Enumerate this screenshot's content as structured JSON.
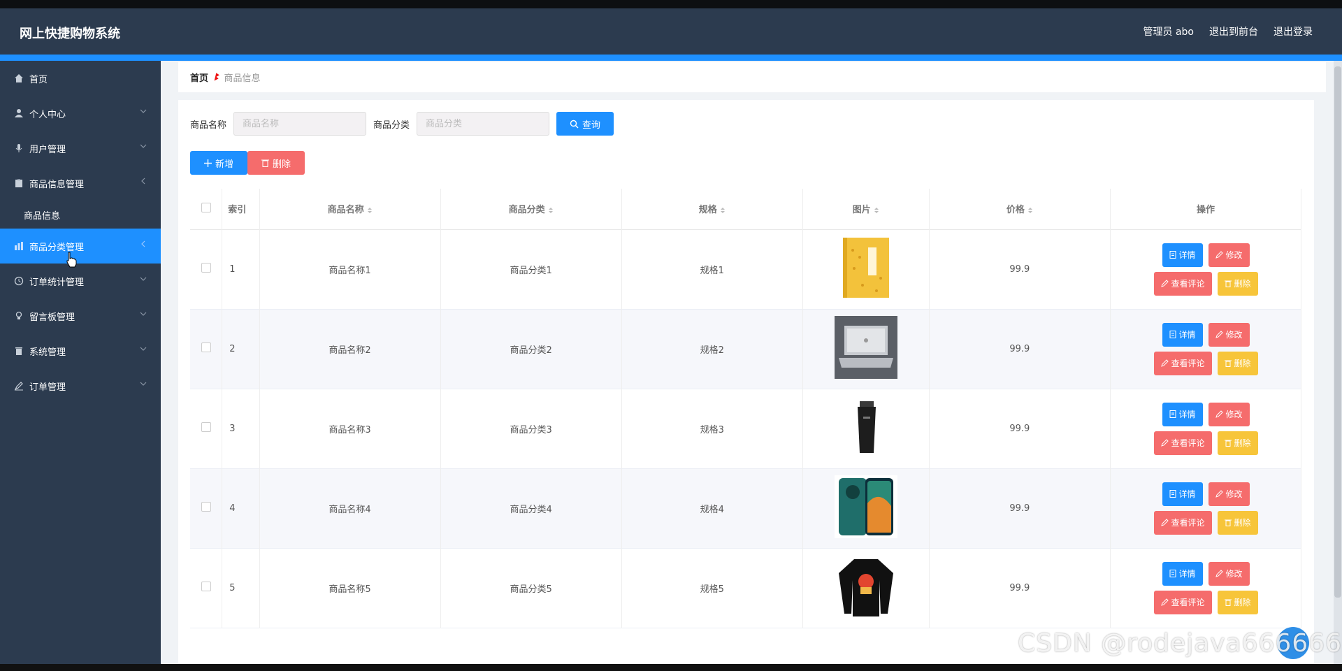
{
  "header": {
    "app_title": "网上快捷购物系统",
    "admin_label": "管理员 abo",
    "to_front": "退出到前台",
    "logout": "退出登录"
  },
  "sidebar": {
    "items": [
      {
        "label": "首页",
        "icon": "home-icon"
      },
      {
        "label": "个人中心",
        "icon": "user-icon"
      },
      {
        "label": "用户管理",
        "icon": "mic-icon"
      },
      {
        "label": "商品信息管理",
        "icon": "clipboard-icon"
      },
      {
        "label": "商品信息",
        "icon": ""
      },
      {
        "label": "商品分类管理",
        "icon": "chart-icon"
      },
      {
        "label": "订单统计管理",
        "icon": "clock-icon"
      },
      {
        "label": "留言板管理",
        "icon": "bulb-icon"
      },
      {
        "label": "系统管理",
        "icon": "trash-icon"
      },
      {
        "label": "订单管理",
        "icon": "pen-icon"
      }
    ]
  },
  "breadcrumb": {
    "home": "首页",
    "separator": "ꔪ",
    "current": "商品信息"
  },
  "search": {
    "name_label": "商品名称",
    "name_placeholder": "商品名称",
    "category_label": "商品分类",
    "category_placeholder": "商品分类",
    "query_button": "查询"
  },
  "actions": {
    "add_button": "新增",
    "delete_button": "删除"
  },
  "table": {
    "columns": [
      "索引",
      "商品名称",
      "商品分类",
      "规格",
      "图片",
      "价格",
      "操作"
    ],
    "rows": [
      {
        "index": "1",
        "name": "商品名称1",
        "category": "商品分类1",
        "spec": "规格1",
        "image": "book",
        "price": "99.9"
      },
      {
        "index": "2",
        "name": "商品名称2",
        "category": "商品分类2",
        "spec": "规格2",
        "image": "laptop",
        "price": "99.9"
      },
      {
        "index": "3",
        "name": "商品名称3",
        "category": "商品分类3",
        "spec": "规格3",
        "image": "tube",
        "price": "99.9"
      },
      {
        "index": "4",
        "name": "商品名称4",
        "category": "商品分类4",
        "spec": "规格4",
        "image": "phone",
        "price": "99.9"
      },
      {
        "index": "5",
        "name": "商品名称5",
        "category": "商品分类5",
        "spec": "规格5",
        "image": "shirt",
        "price": "99.9"
      }
    ],
    "row_actions": {
      "detail": "详情",
      "edit": "修改",
      "review": "查看评论",
      "remove": "删除"
    }
  },
  "watermark": "CSDN @rodejava666666",
  "colors": {
    "topbar": "#2c3b4f",
    "accent": "#1e90ff",
    "danger": "#f56c6c",
    "warning": "#f7c53a"
  }
}
